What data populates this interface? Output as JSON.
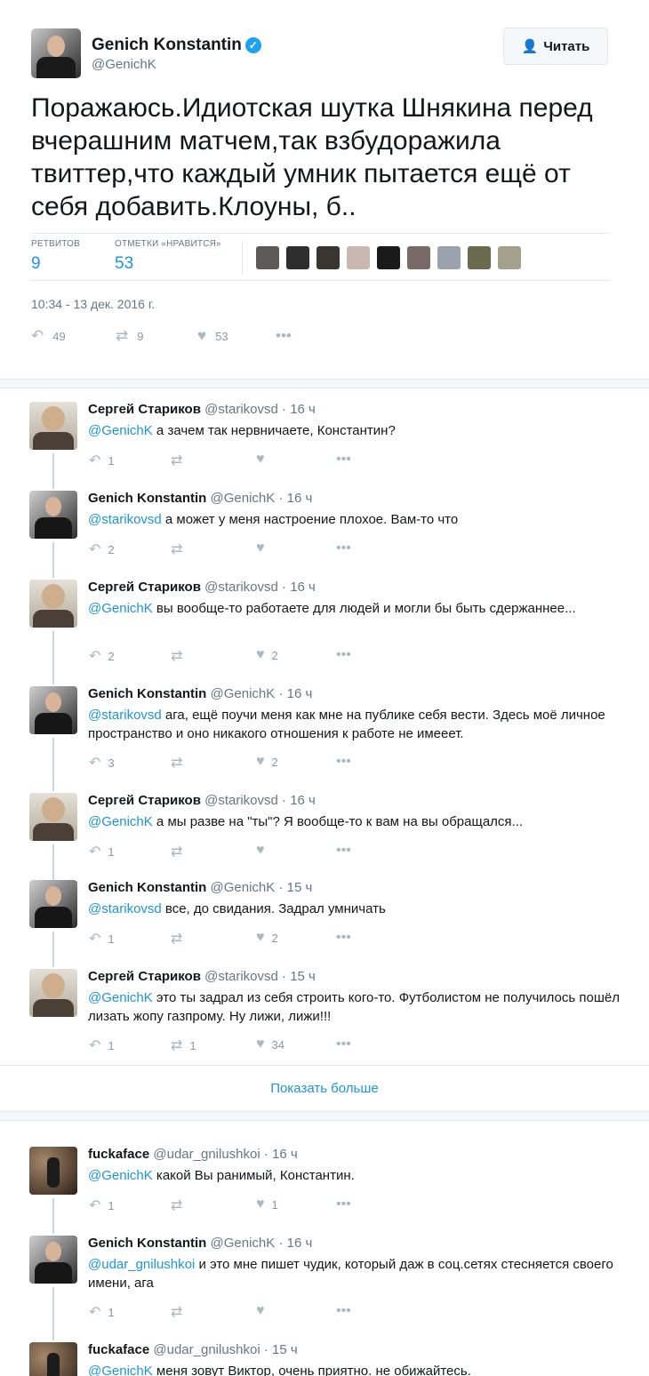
{
  "tweet": {
    "author_name": "Genich Konstantin",
    "author_handle": "@GenichK",
    "follow_label": "Читать",
    "text": "Поражаюсь.Идиотская шутка Шнякина перед вчерашним матчем,так взбудоражила твиттер,что каждый умник пытается ещё от себя добавить.Клоуны, б..",
    "retweets_label": "РЕТВИТОВ",
    "retweets_count": "9",
    "likes_label": "ОТМЕТКИ «НРАВИТСЯ»",
    "likes_count": "53",
    "timestamp": "10:34 - 13 дек. 2016 г.",
    "actions": {
      "reply_count": "49",
      "retweet_count": "9",
      "like_count": "53"
    }
  },
  "liker_colors": [
    "#5d5a57",
    "#2e2e2e",
    "#3b3530",
    "#c9b8b0",
    "#1a1a1a",
    "#7a6a66",
    "#9aa3ad",
    "#6b6a4e",
    "#a4a08c"
  ],
  "colors": {
    "accent": "#1b95e0",
    "muted": "#657786",
    "border": "#e1e8ed"
  },
  "thread1": [
    {
      "name": "Сергей Стариков",
      "handle": "@starikovsd",
      "time": "16 ч",
      "mention": "@GenichK",
      "text": " а зачем так нервничаете, Константин?",
      "replies": "1",
      "retweets": "",
      "likes": ""
    },
    {
      "name": "Genich Konstantin",
      "handle": "@GenichK",
      "time": "16 ч",
      "mention": "@starikovsd",
      "text": " а может у меня настроение плохое. Вам-то что",
      "replies": "2",
      "retweets": "",
      "likes": ""
    },
    {
      "name": "Сергей Стариков",
      "handle": "@starikovsd",
      "time": "16 ч",
      "mention": "@GenichK",
      "text": " вы вообще-то работаете для людей и могли бы быть сдержаннее...",
      "replies": "2",
      "retweets": "",
      "likes": "2"
    },
    {
      "name": "Genich Konstantin",
      "handle": "@GenichK",
      "time": "16 ч",
      "mention": "@starikovsd",
      "text": " ага, ещё поучи меня как мне на публике себя вести. Здесь моё личное пространство и оно никакого отношения к работе не имееет.",
      "replies": "3",
      "retweets": "",
      "likes": "2"
    },
    {
      "name": "Сергей Стариков",
      "handle": "@starikovsd",
      "time": "16 ч",
      "mention": "@GenichK",
      "text": " а мы разве на \"ты\"? Я вообще-то к вам на вы обращался...",
      "replies": "1",
      "retweets": "",
      "likes": ""
    },
    {
      "name": "Genich Konstantin",
      "handle": "@GenichK",
      "time": "15 ч",
      "mention": "@starikovsd",
      "text": " все, до свидания. Задрал умничать",
      "replies": "1",
      "retweets": "",
      "likes": "2"
    },
    {
      "name": "Сергей Стариков",
      "handle": "@starikovsd",
      "time": "15 ч",
      "mention": "@GenichK",
      "text": " это ты задрал из себя строить кого-то. Футболистом не получилось пошёл лизать жопу газпрому. Ну лижи, лижи!!!",
      "replies": "1",
      "retweets": "1",
      "likes": "34"
    }
  ],
  "show_more": "Показать больше",
  "thread2": [
    {
      "name": "fuckaface",
      "handle": "@udar_gnilushkoi",
      "time": "16 ч",
      "mention": "@GenichK",
      "text": " какой Вы ранимый, Константин.",
      "replies": "1",
      "retweets": "",
      "likes": "1"
    },
    {
      "name": "Genich Konstantin",
      "handle": "@GenichK",
      "time": "16 ч",
      "mention": "@udar_gnilushkoi",
      "text": " и это мне пишет чудик, который даж в соц.сетях стесняется своего имени, ага",
      "replies": "1",
      "retweets": "",
      "likes": ""
    },
    {
      "name": "fuckaface",
      "handle": "@udar_gnilushkoi",
      "time": "15 ч",
      "mention": "@GenichK",
      "text": " меня зовут Виктор, очень приятно. не обижайтесь.",
      "replies": "",
      "retweets": "",
      "likes": ""
    }
  ]
}
